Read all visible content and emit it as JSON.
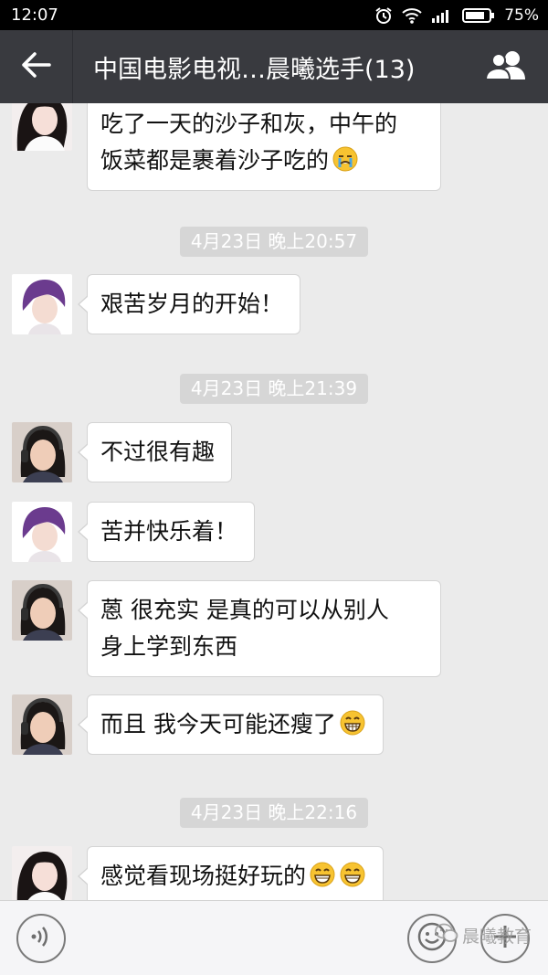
{
  "status_bar": {
    "time": "12:07",
    "battery": "75%"
  },
  "header": {
    "title": "中国电影电视…晨曦选手(13)"
  },
  "messages": [
    {
      "type": "message",
      "avatar": "avatar-girl-long-hair",
      "lines": [
        "吃了一天的沙子和灰，中午的",
        "饭菜都是裹着沙子吃的"
      ],
      "emojis": [
        "crying-face"
      ]
    },
    {
      "type": "timestamp",
      "text": "4月23日 晚上20:57"
    },
    {
      "type": "message",
      "avatar": "avatar-purple-hair",
      "lines": [
        "艰苦岁月的开始！"
      ]
    },
    {
      "type": "timestamp",
      "text": "4月23日 晚上21:39"
    },
    {
      "type": "message",
      "avatar": "avatar-girl-headphones",
      "lines": [
        "不过很有趣"
      ]
    },
    {
      "type": "message",
      "avatar": "avatar-purple-hair",
      "lines": [
        "苦并快乐着！"
      ]
    },
    {
      "type": "message",
      "avatar": "avatar-girl-headphones",
      "lines": [
        "蒽 很充实 是真的可以从别人",
        "身上学到东西"
      ]
    },
    {
      "type": "message",
      "avatar": "avatar-girl-headphones",
      "lines": [
        "而且 我今天可能还瘦了"
      ],
      "emojis": [
        "grin-face"
      ]
    },
    {
      "type": "timestamp",
      "text": "4月23日 晚上22:16"
    },
    {
      "type": "message",
      "avatar": "avatar-girl-long-hair",
      "lines": [
        "感觉看现场挺好玩的"
      ],
      "emojis": [
        "smile-face",
        "smile-face"
      ]
    }
  ],
  "input_bar": {
    "watermark": "晨曦教育"
  },
  "colors": {
    "title_bar": "#393a3f",
    "chat_background": "#ebebeb",
    "bubble": "#ffffff",
    "timestamp_bg": "#d6d6d6"
  }
}
